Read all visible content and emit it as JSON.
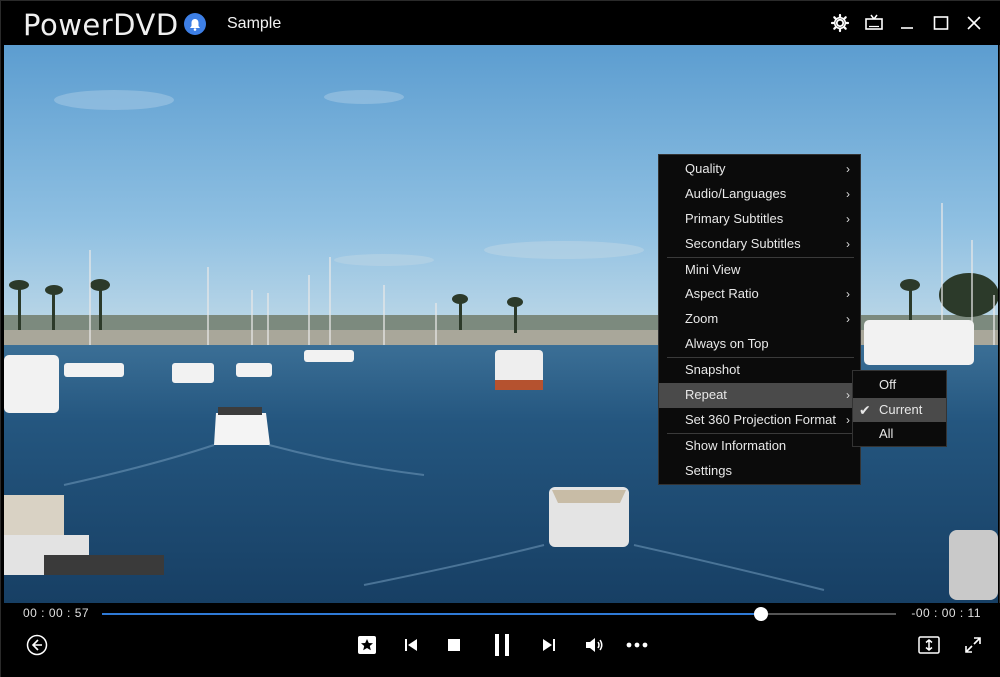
{
  "window": {
    "app_name": "PowerDVD",
    "document_title": "Sample"
  },
  "menu": {
    "items": [
      {
        "label": "Quality",
        "submenu": true
      },
      {
        "label": "Audio/Languages",
        "submenu": true
      },
      {
        "label": "Primary Subtitles",
        "submenu": true
      },
      {
        "label": "Secondary Subtitles",
        "submenu": true
      },
      {
        "label": "Mini View",
        "submenu": false
      },
      {
        "label": "Aspect Ratio",
        "submenu": true
      },
      {
        "label": "Zoom",
        "submenu": true
      },
      {
        "label": "Always on Top",
        "submenu": false
      },
      {
        "label": "Snapshot",
        "submenu": false
      },
      {
        "label": "Repeat",
        "submenu": true,
        "active": true
      },
      {
        "label": "Set 360 Projection Format",
        "submenu": true
      },
      {
        "label": "Show Information",
        "submenu": false
      },
      {
        "label": "Settings",
        "submenu": false
      }
    ],
    "arrow_glyph": "›"
  },
  "repeat_submenu": {
    "items": [
      {
        "label": "Off",
        "checked": false
      },
      {
        "label": "Current",
        "checked": true
      },
      {
        "label": "All",
        "checked": false
      }
    ],
    "check_glyph": "✔"
  },
  "playback": {
    "elapsed": "00 : 00 : 57",
    "remaining": "-00 : 00 : 11",
    "progress_fraction": 0.83
  },
  "colors": {
    "accent": "#2f7ad6",
    "bell": "#3d7fe6",
    "menu_bg": "#0b0b0b",
    "menu_active": "#4a4a4a"
  },
  "icons": {
    "titlebar": [
      "bell-icon",
      "settings-gear-icon",
      "tv-mode-icon",
      "minimize-icon",
      "maximize-icon",
      "close-icon"
    ],
    "controls": [
      "back-icon",
      "bookmark-star-icon",
      "previous-icon",
      "stop-icon",
      "pause-icon",
      "next-icon",
      "volume-icon",
      "more-options-icon",
      "aspect-fit-icon",
      "fullscreen-icon"
    ]
  }
}
